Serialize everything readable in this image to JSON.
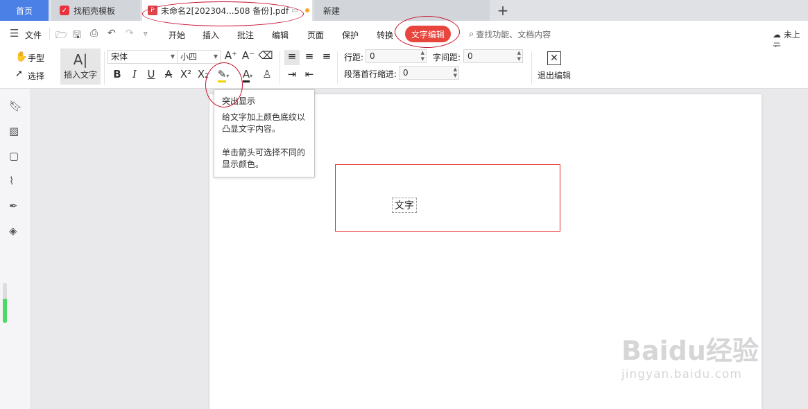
{
  "tabs": {
    "home": "首页",
    "template": "找稻壳模板",
    "document": "未命名2[202304...508 备份].pdf",
    "new": "新建",
    "add": "+"
  },
  "menu": {
    "file": "文件",
    "items": [
      "开始",
      "插入",
      "批注",
      "编辑",
      "页面",
      "保护",
      "转换"
    ],
    "active": "文字编辑",
    "search": "查找功能、文档内容",
    "cloud": "未上云"
  },
  "toolbar": {
    "hand": "手型",
    "select": "选择",
    "insert_text": "插入文字",
    "font_family": "宋体",
    "font_size": "小四",
    "line_spacing_label": "行距:",
    "line_spacing_value": "0",
    "char_spacing_label": "字间距:",
    "char_spacing_value": "0",
    "indent_label": "段落首行缩进:",
    "indent_value": "0",
    "exit_edit": "退出编辑"
  },
  "tooltip": {
    "title": "突出显示",
    "line1": "给文字加上颜色底纹以凸显文字内容。",
    "line2": "单击箭头可选择不同的显示颜色。"
  },
  "document": {
    "text": "文字"
  },
  "watermark": {
    "brand": "Baidu经验",
    "url": "jingyan.baidu.com"
  },
  "colors": {
    "accent": "#e8453c",
    "home_tab": "#4b80e6",
    "highlight": "#f5d000"
  }
}
